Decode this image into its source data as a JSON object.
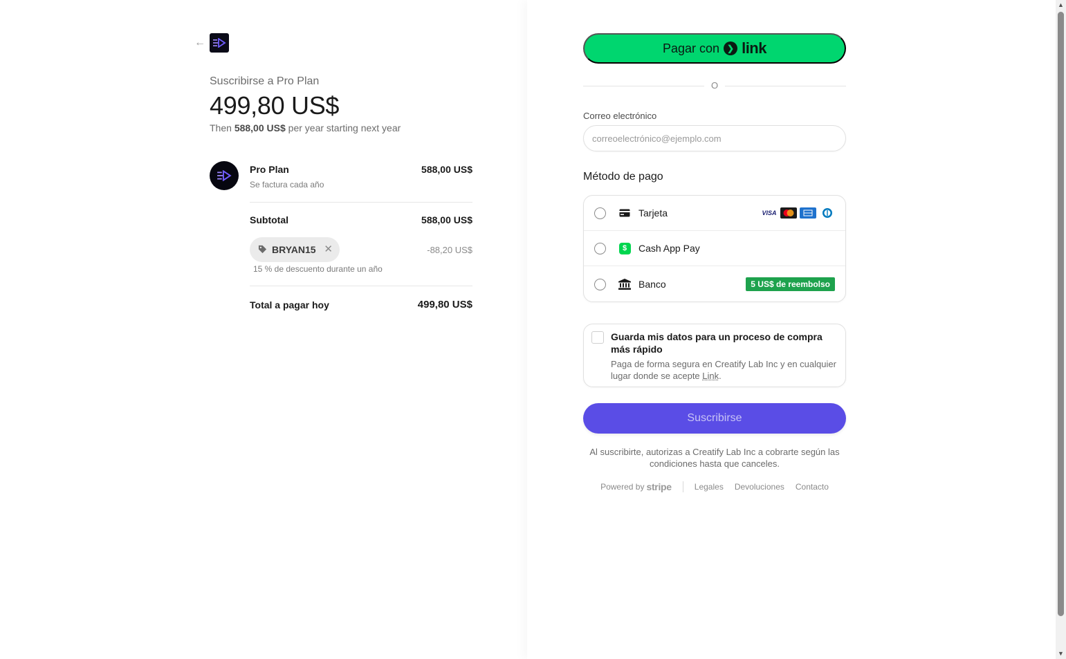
{
  "summary": {
    "subscribe_title": "Suscribirse a Pro Plan",
    "big_price": "499,80 US$",
    "then_prefix": "Then ",
    "then_amount": "588,00 US$",
    "then_suffix": " per year starting next year"
  },
  "line_item": {
    "name": "Pro Plan",
    "billing": "Se factura cada año",
    "price": "588,00 US$"
  },
  "subtotal": {
    "label": "Subtotal",
    "value": "588,00 US$"
  },
  "promo": {
    "code": "BRYAN15",
    "discount": "-88,20 US$",
    "description": "15 % de descuento durante un año"
  },
  "total": {
    "label": "Total a pagar hoy",
    "value": "499,80 US$"
  },
  "link_button": {
    "prefix": "Pagar con",
    "brand": "link"
  },
  "or_text": "O",
  "email": {
    "label": "Correo electrónico",
    "placeholder": "correoelectrónico@ejemplo.com",
    "value": ""
  },
  "payment": {
    "title": "Método de pago",
    "methods": [
      {
        "label": "Tarjeta",
        "icon": "card-icon",
        "brands": [
          "VISA",
          "mastercard",
          "amex",
          "diners"
        ]
      },
      {
        "label": "Cash App Pay",
        "icon": "cash-app-icon"
      },
      {
        "label": "Banco",
        "icon": "bank-icon",
        "badge": "5 US$ de reembolso"
      }
    ]
  },
  "save": {
    "title": "Guarda mis datos para un proceso de compra más rápido",
    "desc_prefix": "Paga de forma segura en Creatify Lab Inc y en cualquier lugar donde se acepte ",
    "desc_link": "Link",
    "desc_suffix": "."
  },
  "subscribe_button": "Suscribirse",
  "legal": "Al suscribirte, autorizas a Creatify Lab Inc a cobrarte según las condiciones hasta que canceles.",
  "footer": {
    "powered_by": "Powered by",
    "stripe": "stripe",
    "links": [
      "Legales",
      "Devoluciones",
      "Contacto"
    ]
  },
  "colors": {
    "link_green": "#00d66f",
    "subscribe_purple": "#5a4de6",
    "cashback_green": "#1ea24d",
    "cash_app_green": "#00d64f"
  }
}
